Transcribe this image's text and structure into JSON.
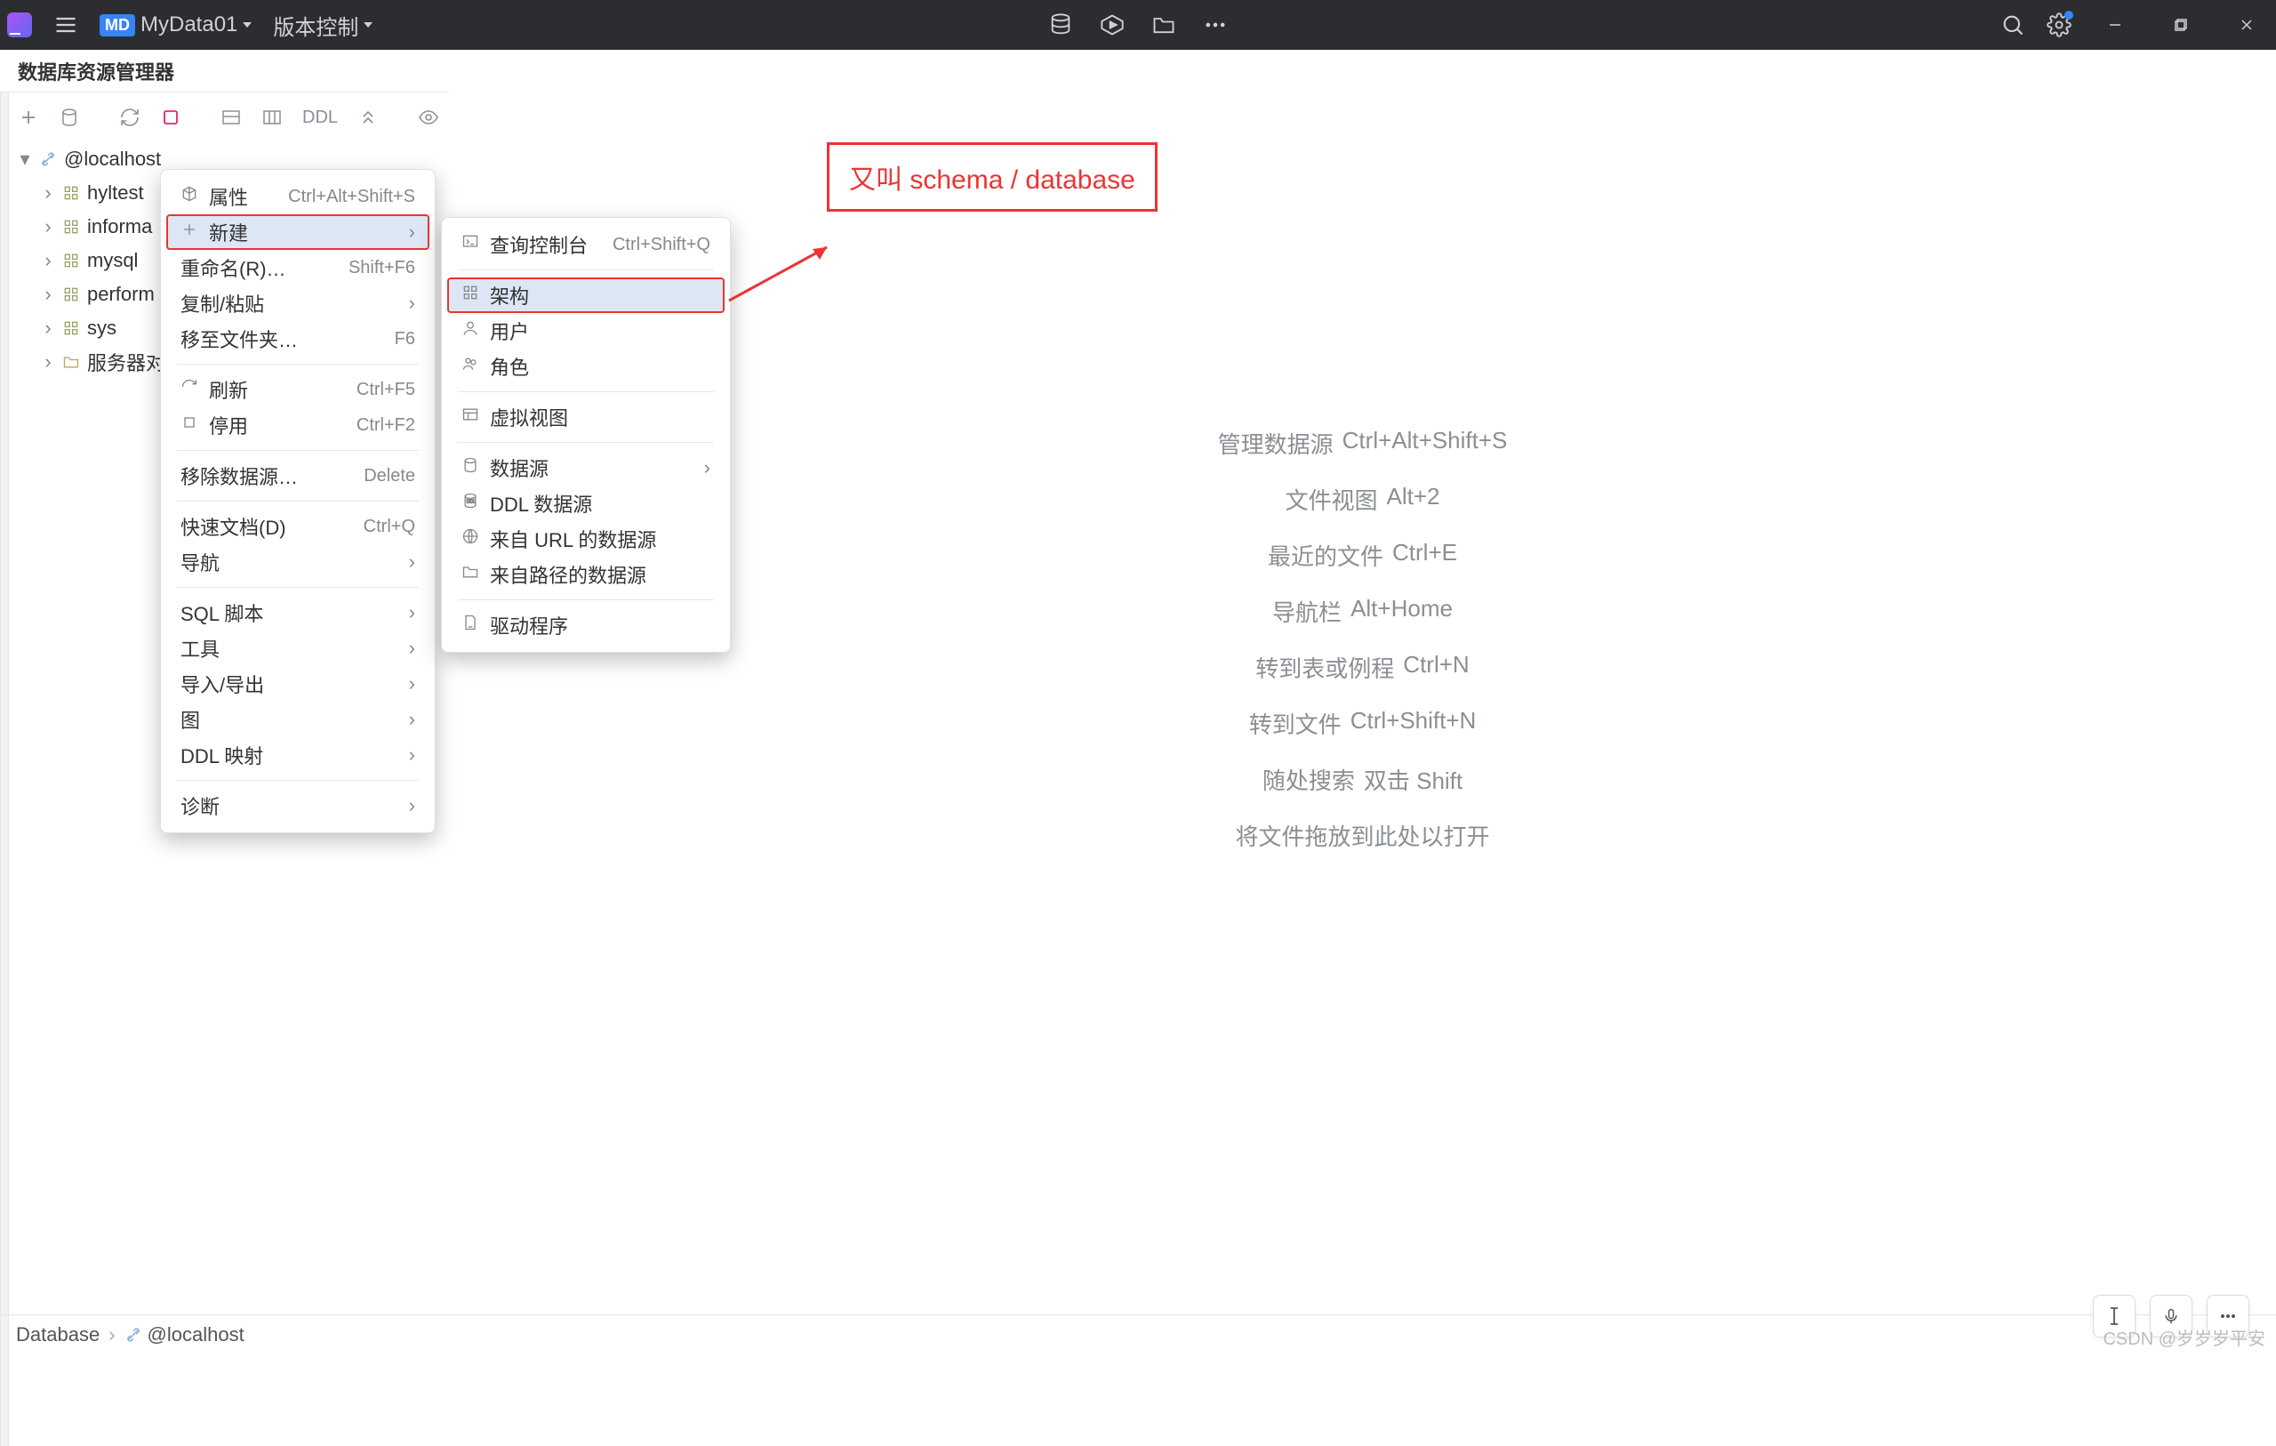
{
  "titlebar": {
    "project_badge": "MD",
    "project_name": "MyData01",
    "vcs_label": "版本控制"
  },
  "panel": {
    "title": "数据库资源管理器"
  },
  "toolbar": {
    "ddl_label": "DDL"
  },
  "tree": {
    "root": "@localhost",
    "items": [
      "hyltest",
      "informa",
      "mysql",
      "perform",
      "sys"
    ],
    "server_objects": "服务器对"
  },
  "hints": [
    {
      "label": "管理数据源",
      "shortcut": "Ctrl+Alt+Shift+S"
    },
    {
      "label": "文件视图",
      "shortcut": "Alt+2"
    },
    {
      "label": "最近的文件",
      "shortcut": "Ctrl+E"
    },
    {
      "label": "导航栏",
      "shortcut": "Alt+Home"
    },
    {
      "label": "转到表或例程",
      "shortcut": "Ctrl+N"
    },
    {
      "label": "转到文件",
      "shortcut": "Ctrl+Shift+N"
    },
    {
      "label": "随处搜索",
      "shortcut": "双击 Shift"
    },
    {
      "label": "将文件拖放到此处以打开",
      "shortcut": ""
    }
  ],
  "ctx1": [
    {
      "icon": "package-icon",
      "label": "属性",
      "shortcut": "Ctrl+Alt+Shift+S",
      "sub": false
    },
    {
      "highlight": true,
      "icon": "plus-icon",
      "label": "新建",
      "shortcut": "",
      "sub": true
    },
    {
      "label": "重命名(R)…",
      "shortcut": "Shift+F6",
      "sub": false
    },
    {
      "label": "复制/粘贴",
      "shortcut": "",
      "sub": true
    },
    {
      "label": "移至文件夹…",
      "shortcut": "F6",
      "sub": false
    },
    {
      "sep": true
    },
    {
      "icon": "refresh-icon",
      "label": "刷新",
      "shortcut": "Ctrl+F5",
      "sub": false
    },
    {
      "icon": "stop-icon",
      "label": "停用",
      "shortcut": "Ctrl+F2",
      "sub": false
    },
    {
      "sep": true
    },
    {
      "label": "移除数据源…",
      "shortcut": "Delete",
      "sub": false
    },
    {
      "sep": true
    },
    {
      "label": "快速文档(D)",
      "shortcut": "Ctrl+Q",
      "sub": false
    },
    {
      "label": "导航",
      "shortcut": "",
      "sub": true
    },
    {
      "sep": true
    },
    {
      "label": "SQL 脚本",
      "shortcut": "",
      "sub": true
    },
    {
      "label": "工具",
      "shortcut": "",
      "sub": true
    },
    {
      "label": "导入/导出",
      "shortcut": "",
      "sub": true
    },
    {
      "label": "图",
      "shortcut": "",
      "sub": true
    },
    {
      "label": "DDL 映射",
      "shortcut": "",
      "sub": true
    },
    {
      "sep": true
    },
    {
      "label": "诊断",
      "shortcut": "",
      "sub": true
    }
  ],
  "ctx2": [
    {
      "icon": "console-icon",
      "label": "查询控制台",
      "shortcut": "Ctrl+Shift+Q",
      "sub": false
    },
    {
      "sep": true
    },
    {
      "highlight": true,
      "icon": "schema-icon",
      "label": "架构",
      "shortcut": "",
      "sub": false
    },
    {
      "icon": "user-icon",
      "label": "用户",
      "shortcut": "",
      "sub": false
    },
    {
      "icon": "role-icon",
      "label": "角色",
      "shortcut": "",
      "sub": false
    },
    {
      "sep": true
    },
    {
      "icon": "view-icon",
      "label": "虚拟视图",
      "shortcut": "",
      "sub": false
    },
    {
      "sep": true
    },
    {
      "icon": "database-icon",
      "label": "数据源",
      "shortcut": "",
      "sub": true
    },
    {
      "icon": "ddl-icon",
      "label": "DDL 数据源",
      "shortcut": "",
      "sub": false
    },
    {
      "icon": "url-icon",
      "label": "来自 URL 的数据源",
      "shortcut": "",
      "sub": false
    },
    {
      "icon": "folder-icon",
      "label": "来自路径的数据源",
      "shortcut": "",
      "sub": false
    },
    {
      "sep": true
    },
    {
      "icon": "driver-icon",
      "label": "驱动程序",
      "shortcut": "",
      "sub": false
    }
  ],
  "annotation": "又叫 schema / database",
  "statusbar": {
    "root": "Database",
    "node": "@localhost"
  },
  "watermark": "CSDN @岁岁岁平安"
}
